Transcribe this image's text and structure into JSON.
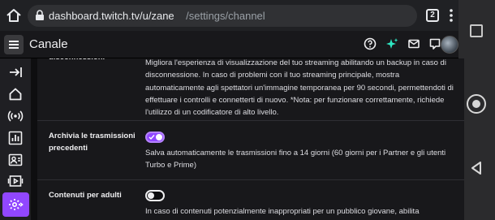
{
  "browser": {
    "url_host": "dashboard.twitch.tv/u/zane",
    "url_path": "/settings/channel",
    "tab_count": "2"
  },
  "header": {
    "title": "Canale"
  },
  "sections": {
    "backup": {
      "label": "disconnessioni",
      "description": "Migliora l'esperienza di visualizzazione del tuo streaming abilitando un backup in caso di disconnessione. In caso di problemi con il tuo streaming principale, mostra automaticamente agli spettatori un'immagine temporanea per 90 secondi, permettendoti di effettuare i controlli e connetterti di nuovo. *Nota: per funzionare correttamente, richiede l'utilizzo di un codificatore di alto livello."
    },
    "archive": {
      "label_line1": "Archivia le trasmissioni",
      "label_line2": "precedenti",
      "toggle_state": "on",
      "description": "Salva automaticamente le trasmissioni fino a 14 giorni (60 giorni per i Partner e gli utenti Turbo e Prime)"
    },
    "mature": {
      "label": "Contenuti per adulti",
      "toggle_state": "off",
      "description": "In caso di contenuti potenzialmente inappropriati per un pubblico giovane, abilita"
    }
  },
  "colors": {
    "accent": "#9147ff",
    "background": "#0e0e10",
    "panel": "#18181b",
    "sidebar": "#1f1f23",
    "text": "#efeff1"
  },
  "icons": {
    "header": [
      "help-icon",
      "sparkle-icon",
      "mail-icon",
      "chat-icon"
    ],
    "sidebar": [
      "collapse-icon",
      "home-icon",
      "broadcast-icon",
      "analytics-icon",
      "community-icon",
      "content-icon",
      "settings-icon"
    ]
  }
}
